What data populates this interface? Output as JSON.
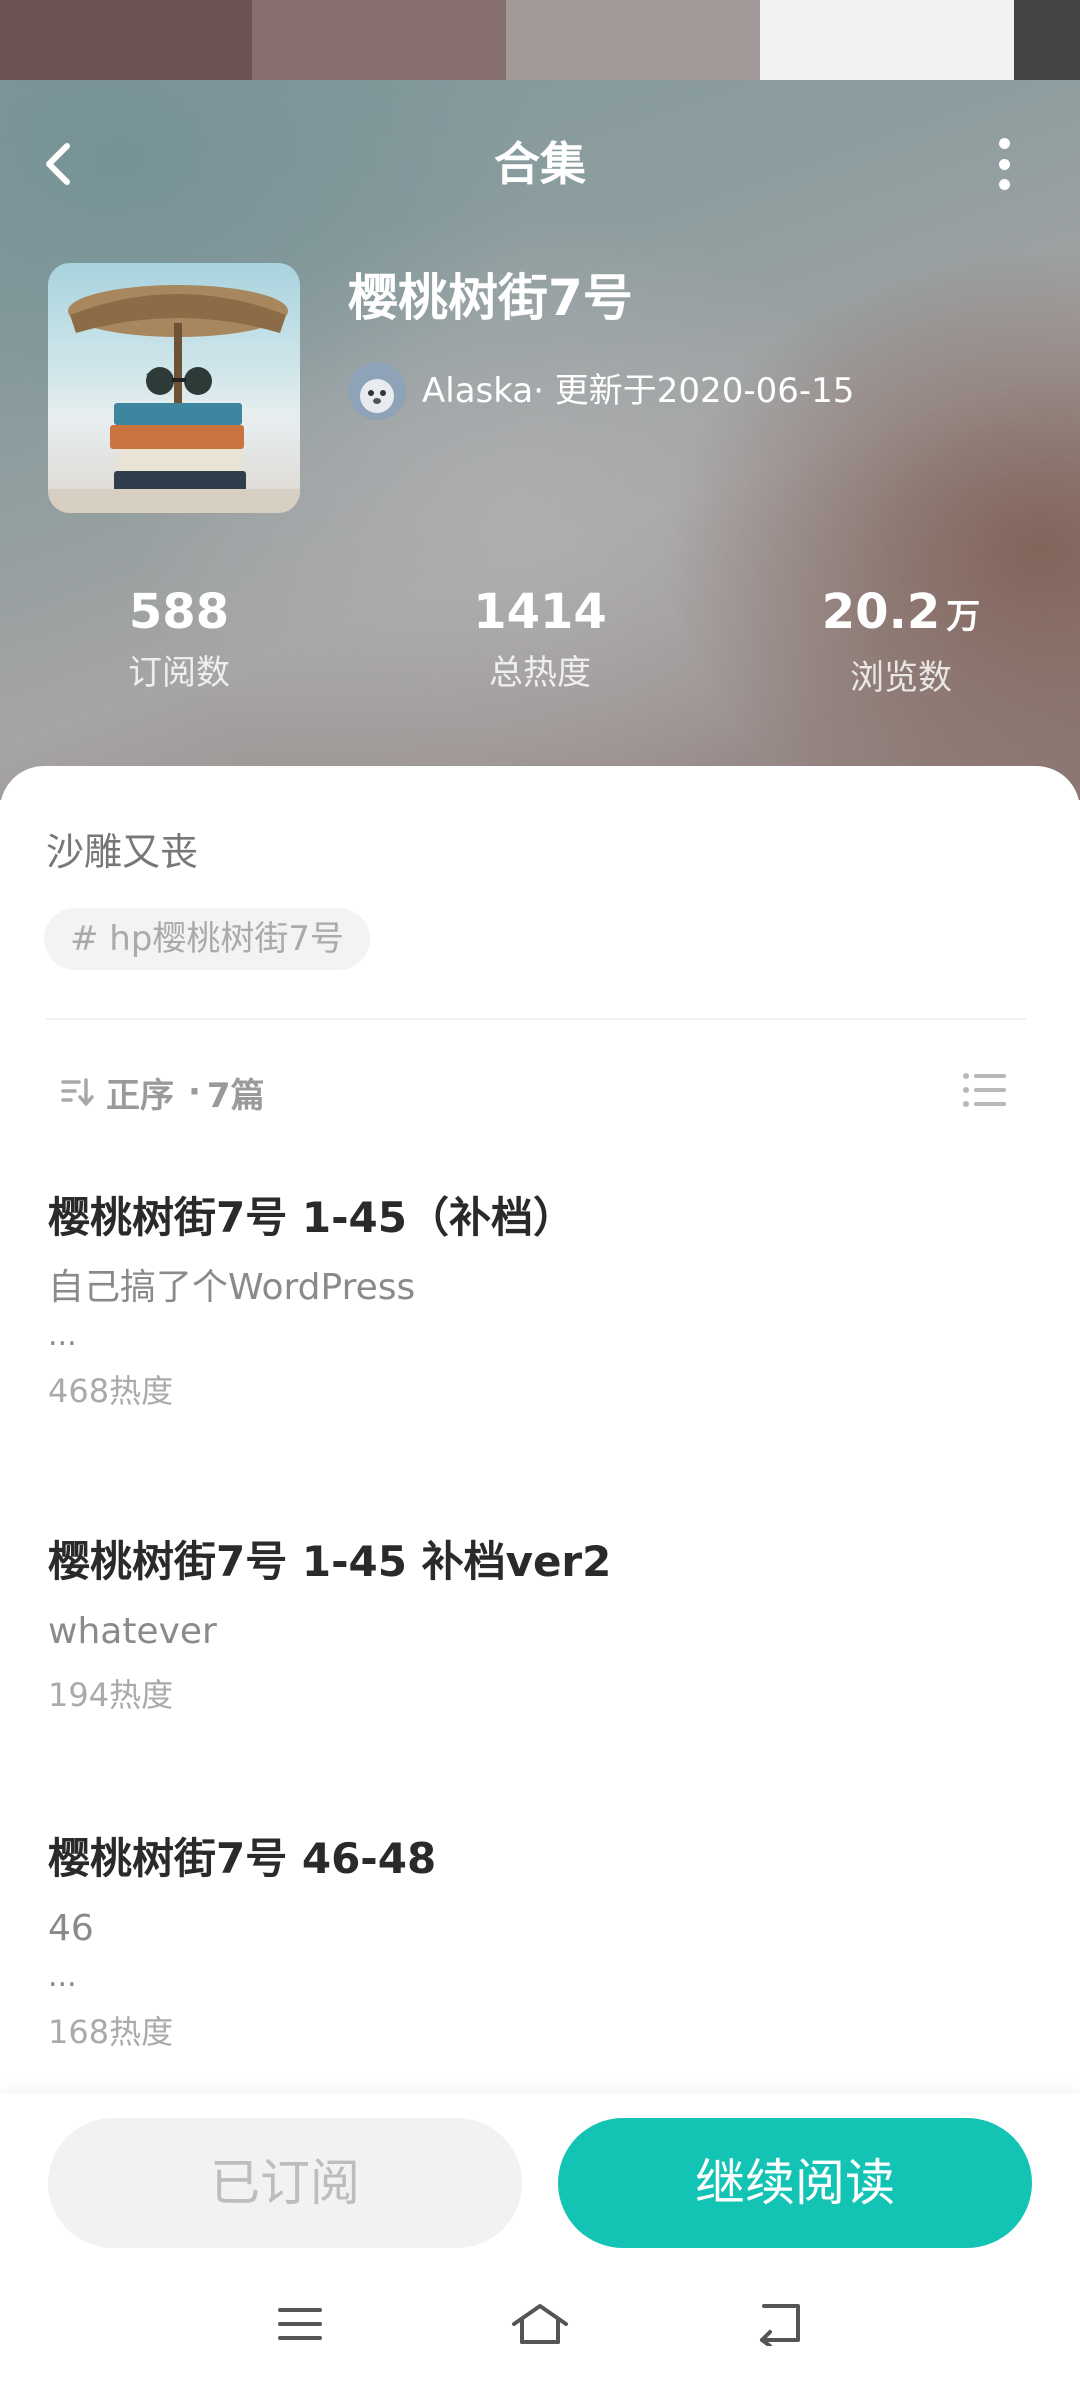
{
  "status_strip": {
    "colors": [
      "#6d5353",
      "#876f6f",
      "#a39999",
      "#f2f2f2",
      "#444444"
    ]
  },
  "header": {
    "title": "合集",
    "back_icon": "chevron-left-icon",
    "more_icon": "more-vertical-icon",
    "series_title": "樱桃树街7号",
    "author_line": "Alaska· 更新于2020-06-15",
    "stats": [
      {
        "value": "588",
        "unit": "",
        "label": "订阅数"
      },
      {
        "value": "1414",
        "unit": "",
        "label": "总热度"
      },
      {
        "value": "20.2",
        "unit": "万",
        "label": "浏览数"
      }
    ]
  },
  "content": {
    "description": "沙雕又丧",
    "tag": "# hp樱桃树街7号",
    "sort_label": "正序",
    "count_label": "7篇",
    "chapters": [
      {
        "title": "樱桃树街7号 1-45（补档）",
        "excerpt": "自己搞了个WordPress",
        "ellipsis": "...",
        "heat": "468热度"
      },
      {
        "title": "樱桃树街7号 1-45 补档ver2",
        "excerpt": "whatever",
        "ellipsis": "",
        "heat": "194热度"
      },
      {
        "title": "樱桃树街7号 46-48",
        "excerpt": "46",
        "ellipsis": "...",
        "heat": "168热度"
      }
    ]
  },
  "actions": {
    "subscribed_label": "已订阅",
    "continue_label": "继续阅读",
    "accent_color": "#13c4b4"
  },
  "system_nav": {
    "icons": [
      "menu-icon",
      "home-icon",
      "back-icon"
    ]
  }
}
